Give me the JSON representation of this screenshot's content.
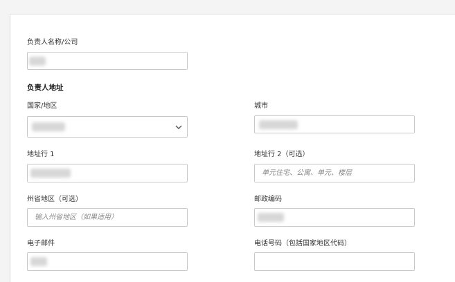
{
  "form": {
    "company_name": {
      "label": "负责人名称/公司",
      "value": ""
    },
    "address_section_title": "负责人地址",
    "country": {
      "label": "国家/地区",
      "value": ""
    },
    "city": {
      "label": "城市",
      "value": ""
    },
    "address_line1": {
      "label": "地址行 1",
      "value": ""
    },
    "address_line2": {
      "label": "地址行 2（可选）",
      "placeholder": "单元住宅、公寓、单元、楼层"
    },
    "state": {
      "label": "州省地区（可选）",
      "placeholder": "输入州省地区（如果适用）"
    },
    "postal_code": {
      "label": "邮政编码",
      "value": ""
    },
    "email": {
      "label": "电子邮件",
      "value": ""
    },
    "phone": {
      "label": "电话号码（包括国家地区代码）",
      "value": ""
    }
  },
  "icons": {
    "country_dropdown": "chevron-down-icon"
  }
}
